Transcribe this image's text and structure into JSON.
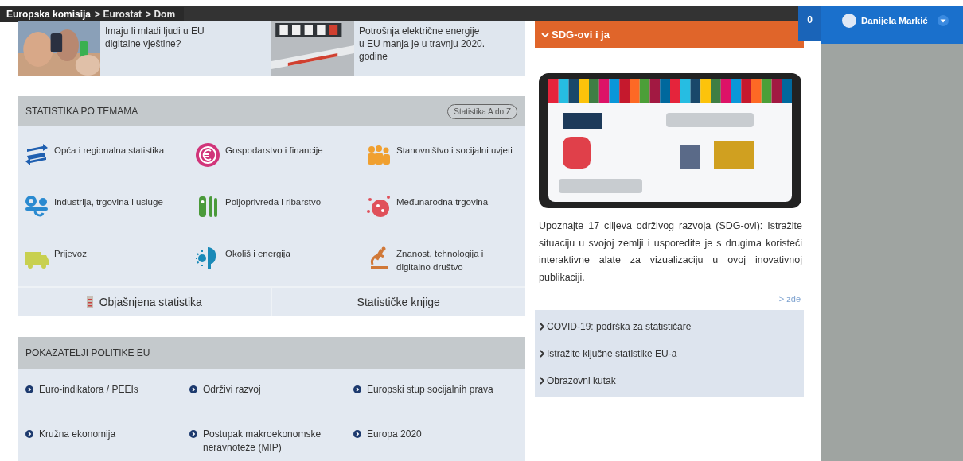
{
  "breadcrumb": [
    {
      "label": "Europska komisija"
    },
    {
      "label": "> Eurostat"
    },
    {
      "label": "> Dom"
    }
  ],
  "notifications": {
    "count": "0"
  },
  "user": {
    "name": "Danijela Markić"
  },
  "news": [
    {
      "kind": "picture",
      "text": "Imaju li mladi ljudi u EU digitalne vještine?"
    },
    {
      "kind": "picture",
      "text": "Potrošnja električne energije u EU manja je u travnju 2020. godine"
    }
  ],
  "topics": {
    "title": "STATISTIKA PO TEMAMA",
    "button": "Statistika A do Z",
    "items": [
      {
        "kind": "arrows",
        "color": "#1f5fb0",
        "label": "Opća i regionalna statistika"
      },
      {
        "kind": "euro",
        "color": "#d1357a",
        "label": "Gospodarstvo i financije"
      },
      {
        "kind": "people",
        "color": "#f0a030",
        "label": "Stanovništvo i socijalni uvjeti"
      },
      {
        "kind": "gears",
        "color": "#2a8ad0",
        "label": "Industrija, trgovina i usluge"
      },
      {
        "kind": "fish",
        "color": "#4a9a3a",
        "label": "Poljoprivreda i ribarstvo"
      },
      {
        "kind": "globe",
        "color": "#e0505a",
        "label": "Međunarodna trgovina"
      },
      {
        "kind": "truck",
        "color": "#c8d050",
        "label": "Prijevoz"
      },
      {
        "kind": "sun",
        "color": "#1a8ab8",
        "label": "Okoliš i energija"
      },
      {
        "kind": "microscope",
        "color": "#d07838",
        "label": "Znanost, tehnologija i digitalno društvo"
      }
    ],
    "footer": [
      "Objašnjena statistika",
      "Statističke knjige"
    ]
  },
  "policy": {
    "title": "POKAZATELJI POLITIKE EU",
    "items": [
      "Euro-indikatora / PEEIs",
      "Održivi razvoj",
      "Europski stup socijalnih prava",
      "Kružna ekonomija",
      "Postupak makroekonomske neravnoteže (MIP)",
      "Europa 2020"
    ]
  },
  "sdg": {
    "title": "SDG-ovi i ja",
    "text": "Upoznajte 17 ciljeva održivog razvoja (SDG-ovi): Istražite situaciju u svojoj zemlji i usporedite je s drugima koristeći interaktivne alate za vizualizaciju u ovoj inovativnoj publikaciji.",
    "more": "> zde",
    "links": [
      "COVID-19: podrška za statističare",
      "Istražite ključne statistike EU-a",
      "Obrazovni kutak"
    ]
  }
}
